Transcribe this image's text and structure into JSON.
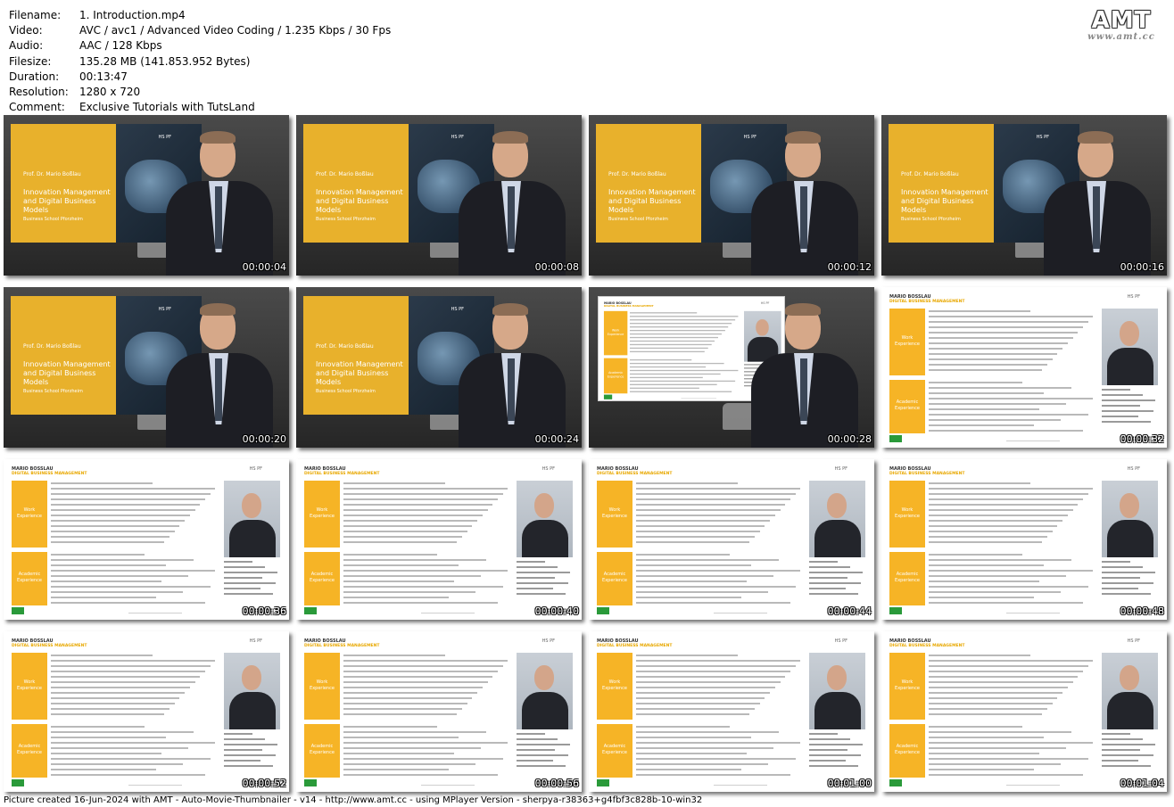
{
  "info": [
    {
      "label": "Filename:",
      "value": "1. Introduction.mp4"
    },
    {
      "label": "Video:",
      "value": "AVC / avc1 / Advanced Video Coding / 1.235 Kbps / 30 Fps"
    },
    {
      "label": "Audio:",
      "value": "AAC / 128 Kbps"
    },
    {
      "label": "Filesize:",
      "value": "135.28 MB (141.853.952 Bytes)"
    },
    {
      "label": "Duration:",
      "value": "00:13:47"
    },
    {
      "label": "Resolution:",
      "value": "1280 x 720"
    },
    {
      "label": "Comment:",
      "value": "Exclusive Tutorials with TutsLand"
    }
  ],
  "logo": {
    "main": "AMT",
    "url": "www.amt.cc"
  },
  "slide_text": {
    "hs": "HS PF",
    "prof": "Prof. Dr. Mario Boßlau",
    "title": "Innovation Management and Digital Business Models",
    "school": "Business School Pforzheim",
    "cv_name": "MARIO BOSSLAU",
    "cv_sub": "DIGITAL BUSINESS MANAGEMENT",
    "work": "Work Experience",
    "academic": "Academic Experience"
  },
  "thumbnails": [
    {
      "time": "00:00:04",
      "kind": "presenter"
    },
    {
      "time": "00:00:08",
      "kind": "presenter"
    },
    {
      "time": "00:00:12",
      "kind": "presenter"
    },
    {
      "time": "00:00:16",
      "kind": "presenter"
    },
    {
      "time": "00:00:20",
      "kind": "presenter"
    },
    {
      "time": "00:00:24",
      "kind": "presenter"
    },
    {
      "time": "00:00:28",
      "kind": "cv-presenter"
    },
    {
      "time": "00:00:32",
      "kind": "cv"
    },
    {
      "time": "00:00:36",
      "kind": "cv"
    },
    {
      "time": "00:00:40",
      "kind": "cv"
    },
    {
      "time": "00:00:44",
      "kind": "cv"
    },
    {
      "time": "00:00:48",
      "kind": "cv"
    },
    {
      "time": "00:00:52",
      "kind": "cv"
    },
    {
      "time": "00:00:56",
      "kind": "cv"
    },
    {
      "time": "00:01:00",
      "kind": "cv"
    },
    {
      "time": "00:01:04",
      "kind": "cv"
    }
  ],
  "footer": "Picture created 16-Jun-2024 with AMT - Auto-Movie-Thumbnailer - v14 - http://www.amt.cc - using MPlayer Version - sherpya-r38363+g4fbf3c828b-10-win32"
}
